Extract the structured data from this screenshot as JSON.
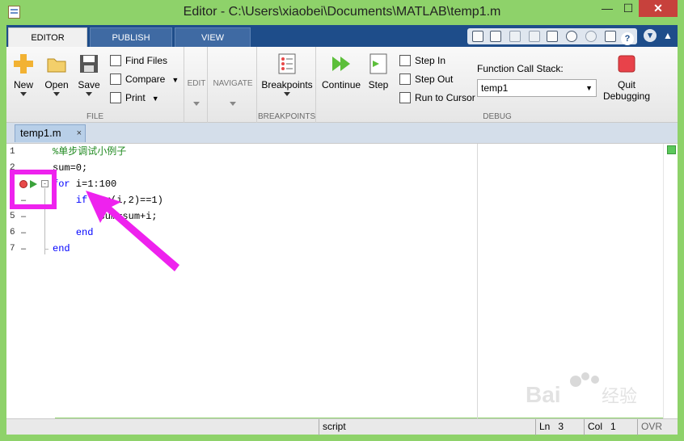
{
  "window": {
    "title": "Editor - C:\\Users\\xiaobei\\Documents\\MATLAB\\temp1.m",
    "minimize": "—",
    "maximize": "☐",
    "close": "✕"
  },
  "tabs": [
    "EDITOR",
    "PUBLISH",
    "VIEW"
  ],
  "ribbon": {
    "file": {
      "new": "New",
      "open": "Open",
      "save": "Save",
      "find_files": "Find Files",
      "compare": "Compare",
      "print": "Print",
      "label": "FILE"
    },
    "edit": {
      "label": "EDIT"
    },
    "navigate": {
      "label": "NAVIGATE"
    },
    "breakpoints": {
      "button": "Breakpoints",
      "label": "BREAKPOINTS"
    },
    "debug": {
      "continue": "Continue",
      "step": "Step",
      "step_in": "Step In",
      "step_out": "Step Out",
      "run_to_cursor": "Run to Cursor",
      "call_stack_label": "Function Call Stack:",
      "call_stack_value": "temp1",
      "quit": "Quit",
      "quit2": "Debugging",
      "label": "DEBUG"
    }
  },
  "document_tab": {
    "name": "temp1.m",
    "close": "×"
  },
  "code": {
    "line_numbers": [
      "1",
      "2",
      "3",
      "4",
      "5",
      "6",
      "7"
    ],
    "lines": [
      {
        "parts": [
          {
            "t": "%单步调试小例子",
            "c": "cm"
          }
        ]
      },
      {
        "parts": [
          {
            "t": "sum=0;",
            "c": ""
          }
        ]
      },
      {
        "parts": [
          {
            "t": "for",
            "c": "kw"
          },
          {
            "t": " i=1:100",
            "c": ""
          }
        ]
      },
      {
        "parts": [
          {
            "t": "    ",
            "c": ""
          },
          {
            "t": "if",
            "c": "kw"
          },
          {
            "t": " rem(i,2)==1)",
            "c": ""
          }
        ]
      },
      {
        "parts": [
          {
            "t": "        sum=sum+i;",
            "c": ""
          }
        ]
      },
      {
        "parts": [
          {
            "t": "    ",
            "c": ""
          },
          {
            "t": "end",
            "c": "kw"
          }
        ]
      },
      {
        "parts": [
          {
            "t": "end",
            "c": "kw"
          }
        ]
      }
    ]
  },
  "status": {
    "mode": "script",
    "ln_label": "Ln",
    "ln_value": "3",
    "col_label": "Col",
    "col_value": "1",
    "ovr": "OVR"
  },
  "colors": {
    "breakpoint": "#e84a4a",
    "highlight": "#ee22ee",
    "accent": "#1e4d8a"
  },
  "watermark": {
    "text": "Bai 经验"
  }
}
